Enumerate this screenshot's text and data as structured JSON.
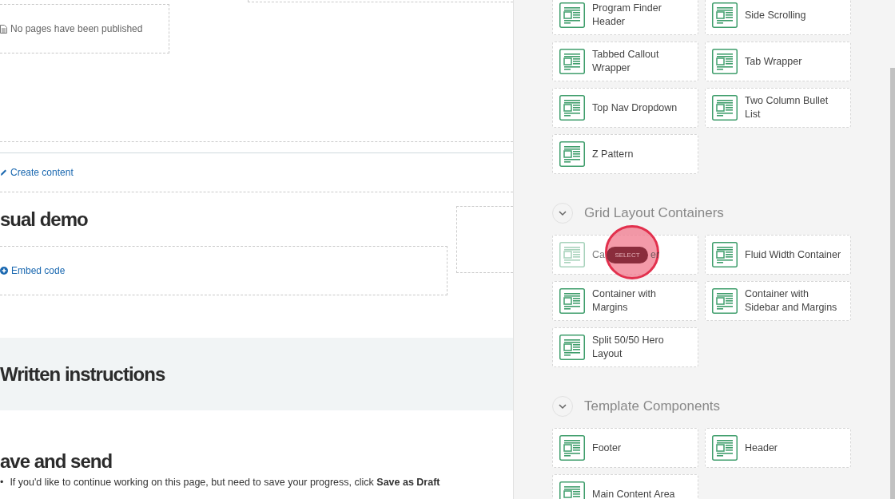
{
  "content": {
    "published_notice": "No pages have been published",
    "create_link": "Create content",
    "demo_heading": "sual demo",
    "embed_link": "Embed code",
    "instructions_heading": "Written instructions",
    "save_heading": "ave and send",
    "bullets": [
      {
        "marker": "•",
        "text": "If you'd like to continue working on this page, but need to save your progress, click **Save as Draft**"
      }
    ]
  },
  "panel": {
    "top_items": [
      {
        "kind": "component",
        "label": "Program Finder Header"
      },
      {
        "kind": "component",
        "label": "Side Scrolling"
      },
      {
        "kind": "component",
        "label": "Tabbed Callout Wrapper"
      },
      {
        "kind": "component",
        "label": "Tab Wrapper"
      },
      {
        "kind": "component",
        "label": "Top Nav Dropdown"
      },
      {
        "kind": "component",
        "label": "Two Column Bullet List"
      },
      {
        "kind": "component",
        "label": "Z Pattern"
      }
    ],
    "sections": [
      {
        "title": "Grid Layout Containers",
        "expanded": true,
        "items": [
          {
            "kind": "covered",
            "label_start": "Ca",
            "label_end": "er",
            "overlay": "SELECT"
          },
          {
            "kind": "component",
            "label": "Fluid Width Container"
          },
          {
            "kind": "component",
            "label": "Container with Margins"
          },
          {
            "kind": "component",
            "label": "Container with Sidebar and Margins"
          },
          {
            "kind": "component",
            "label": "Split 50/50 Hero Layout"
          }
        ]
      },
      {
        "title": "Template Components",
        "expanded": true,
        "items": [
          {
            "kind": "component",
            "label": "Footer"
          },
          {
            "kind": "component",
            "label": "Header"
          },
          {
            "kind": "component",
            "label": "Main Content Area"
          }
        ]
      }
    ]
  }
}
